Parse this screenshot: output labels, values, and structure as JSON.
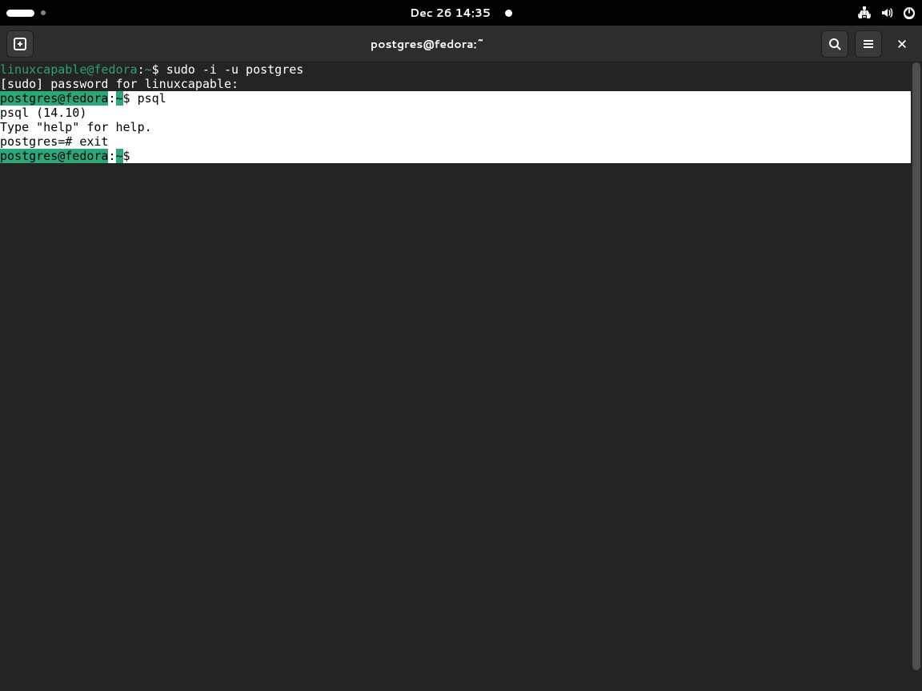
{
  "topbar": {
    "datetime": "Dec 26  14:35"
  },
  "window": {
    "title": "postgres@fedora:~"
  },
  "terminal": {
    "line1": {
      "user": "linuxcapable@fedora",
      "colon": ":",
      "tilde": "~",
      "dollar": "$ ",
      "cmd": "sudo -i -u postgres"
    },
    "line2": "[sudo] password for linuxcapable: ",
    "line3": {
      "user": "postgres@fedora",
      "colon": ":",
      "tilde": "~",
      "dollar": "$ ",
      "cmd": "psql"
    },
    "line4": "psql (14.10)",
    "line5": "Type \"help\" for help.",
    "line6": "",
    "line7": "postgres=# exit",
    "line8": {
      "user": "postgres@fedora",
      "colon": ":",
      "tilde": "~",
      "dollar": "$ "
    }
  }
}
